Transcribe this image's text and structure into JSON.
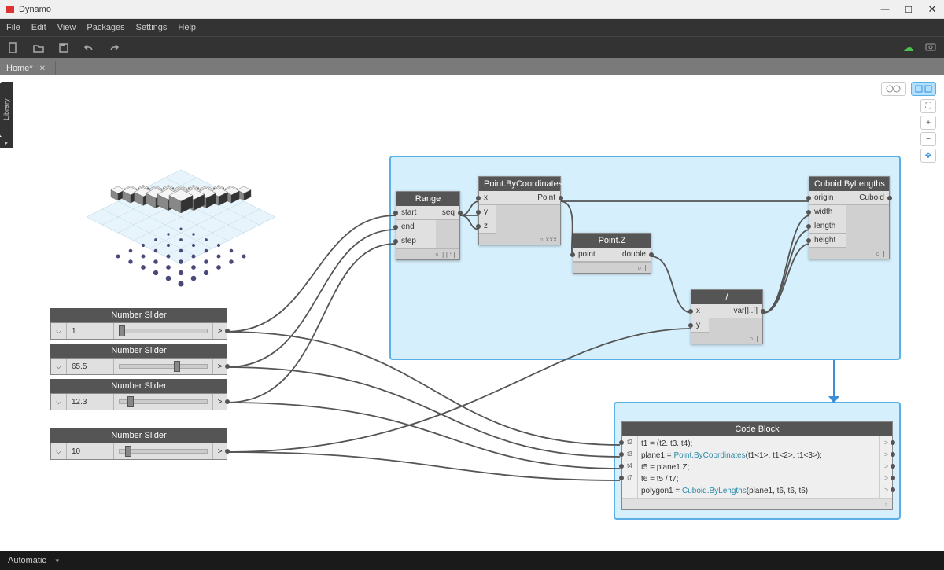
{
  "window": {
    "title": "Dynamo"
  },
  "menu": {
    "items": [
      "File",
      "Edit",
      "View",
      "Packages",
      "Settings",
      "Help"
    ]
  },
  "tabs": [
    {
      "label": "Home*"
    }
  ],
  "library_label": "Library",
  "status": {
    "run_mode": "Automatic"
  },
  "sliders": [
    {
      "label": "Number Slider",
      "value": "1",
      "thumb_pct": 2
    },
    {
      "label": "Number Slider",
      "value": "65.5",
      "thumb_pct": 58
    },
    {
      "label": "Number Slider",
      "value": "12.3",
      "thumb_pct": 11
    },
    {
      "label": "Number Slider",
      "value": "10",
      "thumb_pct": 9
    }
  ],
  "nodes": {
    "range": {
      "title": "Range",
      "ins": [
        "start",
        "end",
        "step"
      ],
      "outs": [
        "seq"
      ]
    },
    "point": {
      "title": "Point.ByCoordinates",
      "ins": [
        "x",
        "y",
        "z"
      ],
      "outs": [
        "Point"
      ]
    },
    "pointz": {
      "title": "Point.Z",
      "ins": [
        "point"
      ],
      "outs": [
        "double"
      ]
    },
    "divide": {
      "title": "/",
      "ins": [
        "x",
        "y"
      ],
      "outs": [
        "var[]..[]"
      ]
    },
    "cuboid": {
      "title": "Cuboid.ByLengths",
      "ins": [
        "origin",
        "width",
        "length",
        "height"
      ],
      "outs": [
        "Cuboid"
      ]
    }
  },
  "codeblock": {
    "title": "Code Block",
    "in_labels": [
      "t2",
      "t3",
      "t4",
      "t7"
    ],
    "lines": [
      {
        "raw": "t1 = (t2..t3..t4);"
      },
      {
        "raw": "plane1 = ",
        "fn": "Point.ByCoordinates",
        "rest": "(t1<1>, t1<2>, t1<3>);"
      },
      {
        "raw": "t5 = plane1.Z;"
      },
      {
        "raw": "t6 = t5 / t7;"
      },
      {
        "raw": "polygon1 = ",
        "fn": "Cuboid.ByLengths",
        "rest": "(plane1, t6, t6, t6);"
      }
    ]
  },
  "symbols": {
    "chevron_out": ">",
    "footer_sq": "▫"
  }
}
